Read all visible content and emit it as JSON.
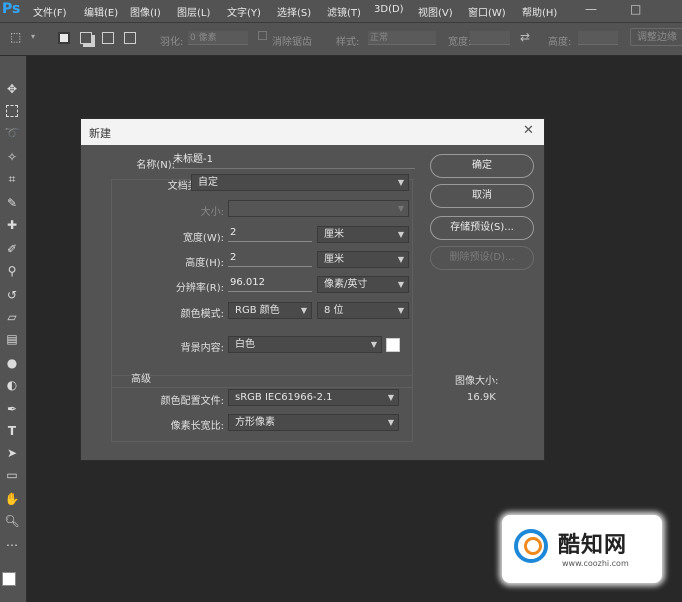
{
  "app": {
    "logo": "Ps"
  },
  "menu": [
    "文件(F)",
    "编辑(E)",
    "图像(I)",
    "图层(L)",
    "文字(Y)",
    "选择(S)",
    "滤镜(T)",
    "3D(D)",
    "视图(V)",
    "窗口(W)",
    "帮助(H)"
  ],
  "options": {
    "feather_label": "羽化:",
    "feather_value": "0 像素",
    "antialias_label": "消除锯齿",
    "style_label": "样式:",
    "style_value": "正常",
    "width_label": "宽度:",
    "height_label": "高度:",
    "refine_label": "调整边缘"
  },
  "dialog": {
    "title": "新建",
    "name_label": "名称(N):",
    "name_value": "未标题-1",
    "preset_label": "文档类型:",
    "preset_value": "自定",
    "size_label": "大小:",
    "width_label": "宽度(W):",
    "width_value": "2",
    "width_unit": "厘米",
    "height_label": "高度(H):",
    "height_value": "2",
    "height_unit": "厘米",
    "res_label": "分辨率(R):",
    "res_value": "96.012",
    "res_unit": "像素/英寸",
    "mode_label": "颜色模式:",
    "mode_value": "RGB 颜色",
    "bits_value": "8 位",
    "bg_label": "背景内容:",
    "bg_value": "白色",
    "advanced_label": "高级",
    "profile_label": "颜色配置文件:",
    "profile_value": "sRGB IEC61966-2.1",
    "aspect_label": "像素长宽比:",
    "aspect_value": "方形像素",
    "ok": "确定",
    "cancel": "取消",
    "save_preset": "存储预设(S)...",
    "delete_preset": "删除预设(D)...",
    "image_size_label": "图像大小:",
    "image_size_value": "16.9K"
  },
  "watermark": {
    "brand": "酷知网",
    "url": "www.coozhi.com"
  }
}
